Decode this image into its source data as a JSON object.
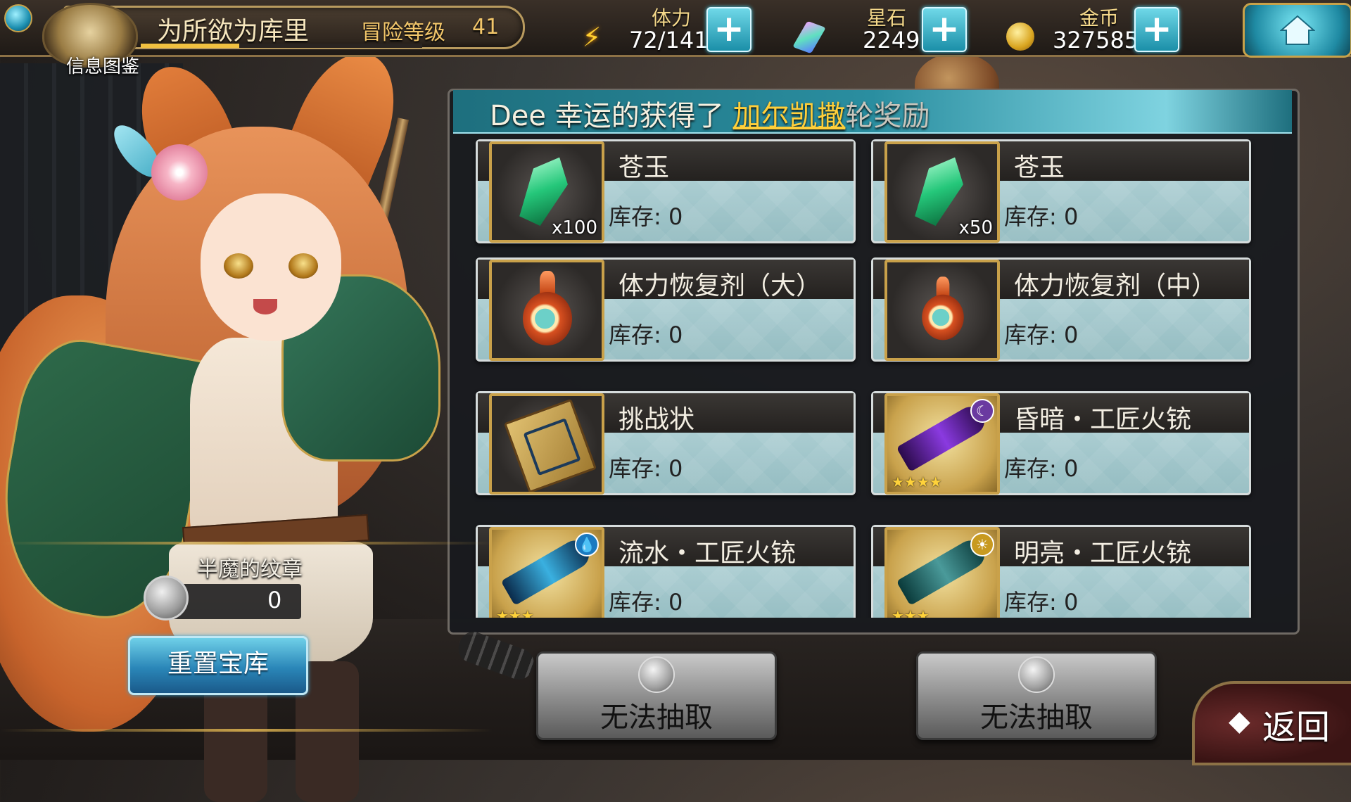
{
  "player": {
    "name": "为所欲为库里",
    "adventure_label": "冒险等级",
    "adventure_level": "41",
    "exp_fraction": 0.35,
    "info_label": "信息图鉴"
  },
  "resources": {
    "stamina": {
      "label": "体力",
      "value": "72/141",
      "icon": "lightning-icon"
    },
    "star_stone": {
      "label": "星石",
      "value": "2249",
      "icon": "crystal-icon"
    },
    "gold": {
      "label": "金币",
      "value": "327585",
      "icon": "coin-icon"
    },
    "plus_symbol": "+"
  },
  "home_button": {
    "icon": "home-icon"
  },
  "panel": {
    "title_prefix": "Dee 幸运的获得了 ",
    "title_highlight": "加尔凯撒",
    "title_suffix": "轮奖励"
  },
  "rewards": [
    {
      "name": "苍玉",
      "stock_label": "库存: 0",
      "quantity": "x100",
      "icon": "jade-icon"
    },
    {
      "name": "苍玉",
      "stock_label": "库存: 0",
      "quantity": "x50",
      "icon": "jade-icon"
    },
    {
      "name": "体力恢复剂（大）",
      "stock_label": "库存: 0",
      "icon": "potion-large-icon"
    },
    {
      "name": "体力恢复剂（中）",
      "stock_label": "库存: 0",
      "icon": "potion-medium-icon"
    },
    {
      "name": "挑战状",
      "stock_label": "库存: 0",
      "icon": "challenge-letter-icon"
    },
    {
      "name": "昏暗・工匠火铳",
      "stock_label": "库存: 0",
      "stars": "★★★★",
      "element_symbol": "☾",
      "icon": "purple-gun-icon"
    },
    {
      "name": "流水・工匠火铳",
      "stock_label": "库存: 0",
      "stars": "★★★",
      "element_symbol": "💧",
      "icon": "blue-gun-icon"
    },
    {
      "name": "明亮・工匠火铳",
      "stock_label": "库存: 0",
      "stars": "★★★",
      "element_symbol": "☀",
      "icon": "teal-gun-icon"
    }
  ],
  "emblem": {
    "label": "半魔的纹章",
    "value": "0"
  },
  "reset_button": {
    "label": "重置宝库"
  },
  "draw_buttons": [
    {
      "label": "无法抽取"
    },
    {
      "label": "无法抽取"
    }
  ],
  "back_button": {
    "label": "返回",
    "arrow": "◆"
  },
  "colors": {
    "header_teal": "#2a8ea0",
    "highlight_gold": "#ffcf3a",
    "card_bg": "#b9d8dc",
    "reset_blue": "#2a86b8"
  }
}
